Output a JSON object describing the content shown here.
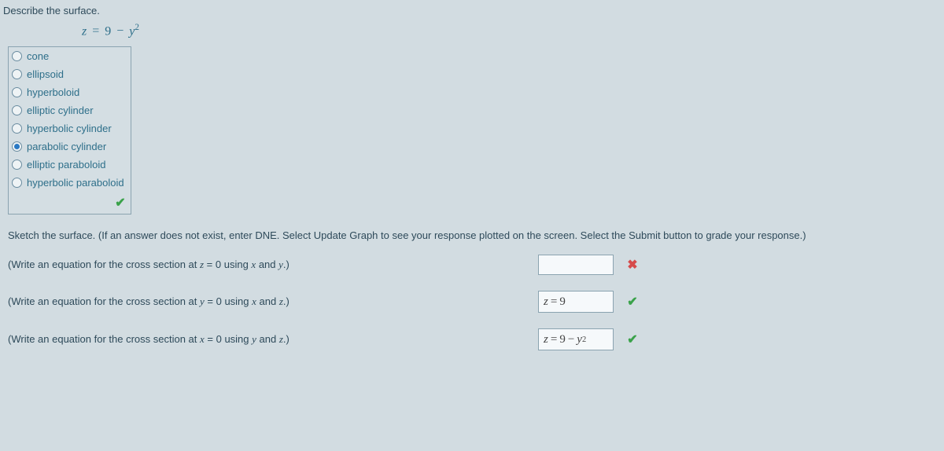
{
  "question": {
    "title": "Describe the surface."
  },
  "equation": {
    "html": "<span class='ital'>z</span> <span class='eq'>=</span> <span class='num'>9</span> <span class='minus'>−</span> <span class='ital'>y</span><sup>2</sup>"
  },
  "choices": [
    {
      "label": "cone",
      "selected": false
    },
    {
      "label": "ellipsoid",
      "selected": false
    },
    {
      "label": "hyperboloid",
      "selected": false
    },
    {
      "label": "elliptic cylinder",
      "selected": false
    },
    {
      "label": "hyperbolic cylinder",
      "selected": false
    },
    {
      "label": "parabolic cylinder",
      "selected": true
    },
    {
      "label": "elliptic paraboloid",
      "selected": false
    },
    {
      "label": "hyperbolic paraboloid",
      "selected": false
    }
  ],
  "choice_status": "correct",
  "sketch_text": "Sketch the surface. (If an answer does not exist, enter DNE. Select Update Graph to see your response plotted on the screen. Select the Submit button to grade your response.)",
  "cross_sections": [
    {
      "label_html": "(Write an equation for the cross section at <span class='ital'>z</span> = 0 using <span class='ital'>x</span> and <span class='ital'>y</span>.)",
      "answer_html": "",
      "status": "wrong"
    },
    {
      "label_html": "(Write an equation for the cross section at <span class='ital'>y</span> = 0 using <span class='ital'>x</span> and <span class='ital'>z</span>.)",
      "answer_html": "<span class='ital'>z</span> <span class='eq'>=</span> <span class='num'>9</span>",
      "status": "correct"
    },
    {
      "label_html": "(Write an equation for the cross section at <span class='ital'>x</span> = 0 using <span class='ital'>y</span> and <span class='ital'>z</span>.)",
      "answer_html": "<span class='ital'>z</span> <span class='eq'>=</span> <span class='num'>9</span> <span class='minus'>−</span> <span class='ital'>y</span><sup>2</sup>",
      "status": "correct"
    }
  ]
}
